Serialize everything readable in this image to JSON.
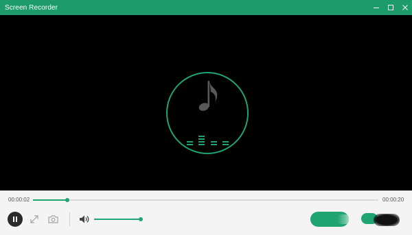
{
  "window": {
    "title": "Screen Recorder",
    "controls": [
      "minimize-icon",
      "maximize-icon",
      "close-icon"
    ]
  },
  "playback": {
    "current_time": "00:00:02",
    "total_time": "00:00:20",
    "progress": 0.1
  },
  "volume": {
    "level": 1.0
  },
  "icons": {
    "pause": "pause-icon",
    "expand": "expand-icon",
    "camera": "camera-icon",
    "volume": "speaker-icon",
    "audio": "music-note-icon"
  },
  "colors": {
    "accent": "#1ea572",
    "titlebar": "#1d9b6a",
    "preview_bg": "#000000",
    "panel_bg": "#f4f4f4"
  }
}
